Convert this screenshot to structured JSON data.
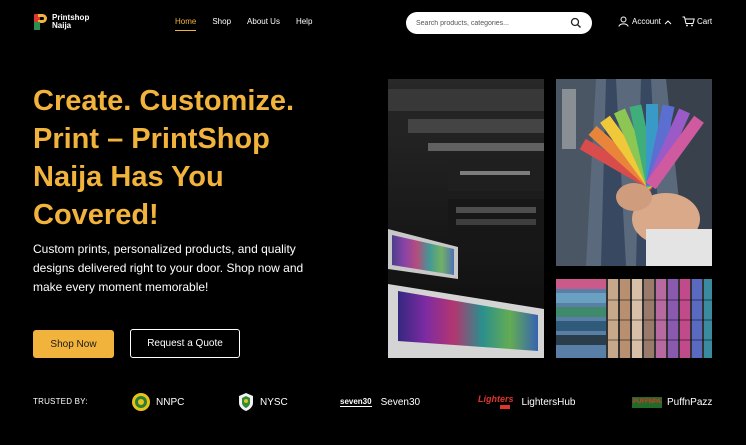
{
  "header": {
    "logo_line1": "Printshop",
    "logo_line2": "Naija",
    "nav": [
      {
        "label": "Home",
        "active": true
      },
      {
        "label": "Shop",
        "active": false
      },
      {
        "label": "About Us",
        "active": false
      },
      {
        "label": "Help",
        "active": false
      }
    ],
    "search_placeholder": "Search products, categories...",
    "account_label": "Account",
    "cart_label": "Cart"
  },
  "hero": {
    "title_line1": "Create. Customize.",
    "title_line2": "Print – PrintShop",
    "title_line3": "Naija Has You",
    "title_line4": "Covered!",
    "subtitle_line1": "Custom prints, personalized products, and quality",
    "subtitle_line2": "designs delivered right to your door. Shop now and",
    "subtitle_line3": "make every moment memorable!",
    "primary_button": "Shop Now",
    "secondary_button": "Request a Quote"
  },
  "trusted": {
    "label": "TRUSTED BY:",
    "brands": [
      {
        "name": "NNPC",
        "icon": "nnpc-logo"
      },
      {
        "name": "NYSC",
        "icon": "nysc-logo"
      },
      {
        "name": "Seven30",
        "icon": "seven30-logo",
        "logo_text": "seven30"
      },
      {
        "name": "LightersHub",
        "icon": "lightershub-logo",
        "logo_text": "Lighters"
      },
      {
        "name": "PuffnPazz",
        "icon": "puffnpazz-logo",
        "logo_text": "PUFFNPAZZ"
      }
    ]
  },
  "colors": {
    "accent": "#f2b33d",
    "background": "#000000",
    "text": "#ffffff"
  }
}
